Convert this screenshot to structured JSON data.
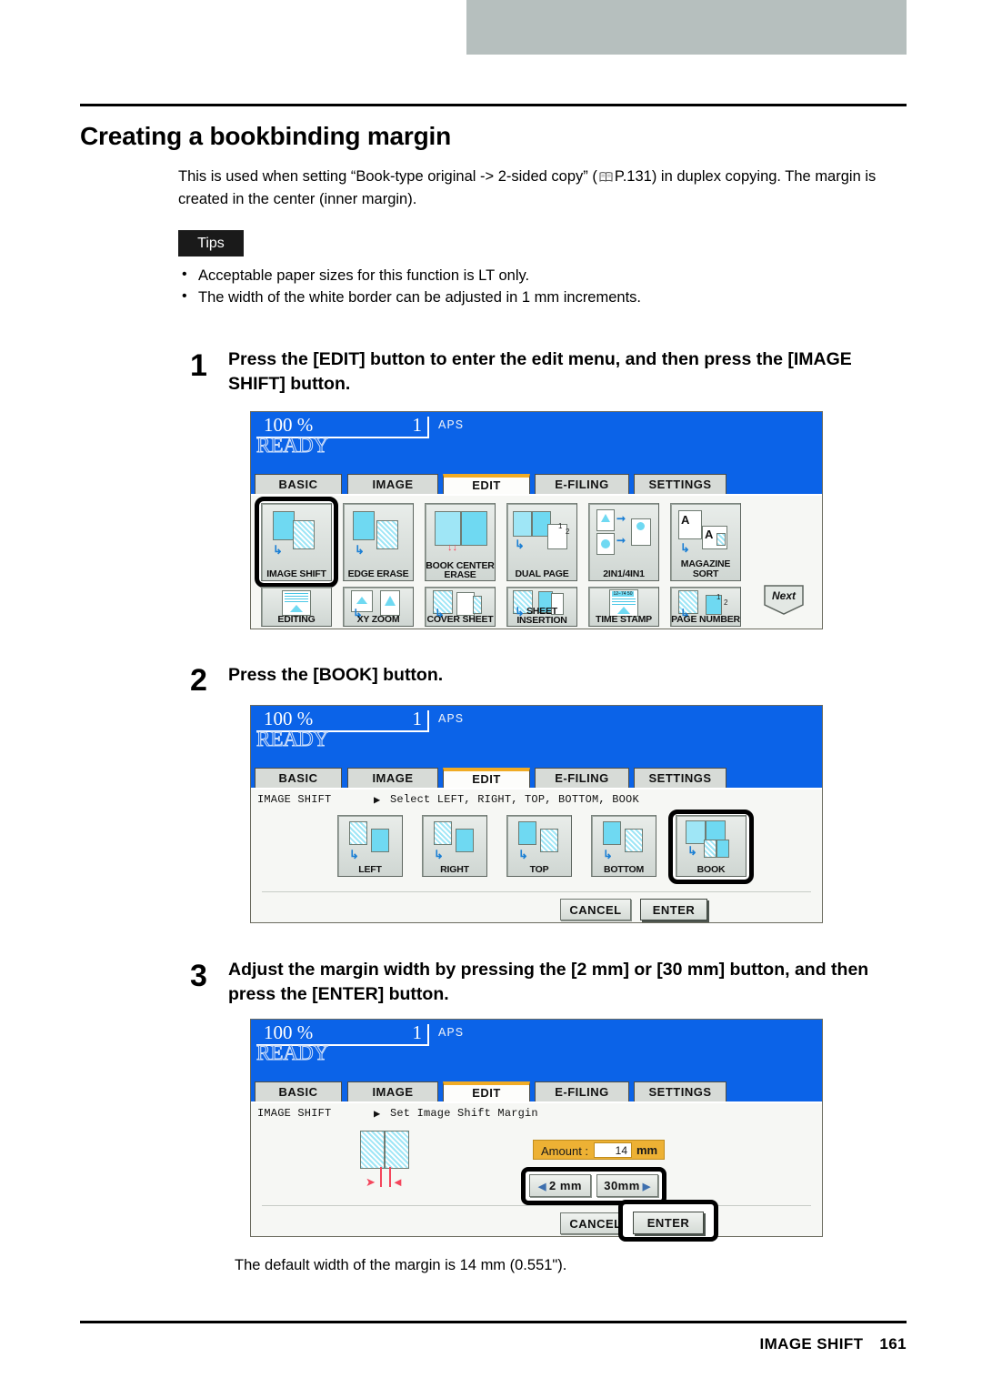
{
  "document": {
    "title": "Creating a bookbinding margin",
    "intro": "This is used when setting “Book-type original -> 2-sided copy” (  P.131) in duplex copying. The margin is created in the center (inner margin).",
    "intro_prefix": "This is used when setting “Book-type original -> 2-sided copy” (",
    "intro_ref": "P.131",
    "intro_suffix": ") in duplex copying. The margin is created in the center (inner margin).",
    "tips_label": "Tips",
    "tips": [
      "Acceptable paper sizes for this function is LT only.",
      "The width of the white border can be adjusted in 1 mm increments."
    ],
    "note": "The default width of the margin is 14 mm (0.551\").",
    "footer_title": "IMAGE SHIFT",
    "footer_page": "161"
  },
  "steps": [
    {
      "number": "1",
      "text": "Press the [EDIT] button to enter the edit menu, and then press the [IMAGE SHIFT] button."
    },
    {
      "number": "2",
      "text": "Press the [BOOK] button."
    },
    {
      "number": "3",
      "text": "Adjust the margin width by pressing the [2 mm] or [30 mm] button, and then press the [ENTER] button."
    }
  ],
  "lcd": {
    "ratio": "100  %",
    "copies": "1",
    "paper_mode": "APS",
    "status": "READY",
    "tabs": [
      {
        "label": "BASIC",
        "active": false
      },
      {
        "label": "IMAGE",
        "active": false
      },
      {
        "label": "EDIT",
        "active": true
      },
      {
        "label": "E-FILING",
        "active": false
      },
      {
        "label": "SETTINGS",
        "active": false
      }
    ]
  },
  "screen1": {
    "menu_row1": [
      {
        "label": "IMAGE SHIFT",
        "icon": "image-shift-icon",
        "selected": true
      },
      {
        "label": "EDGE ERASE",
        "icon": "edge-erase-icon",
        "selected": false
      },
      {
        "label_line1": "BOOK CENTER",
        "label_line2": "ERASE",
        "label": "BOOK CENTER ERASE",
        "icon": "book-center-erase-icon",
        "selected": false
      },
      {
        "label": "DUAL  PAGE",
        "icon": "dual-page-icon",
        "selected": false
      },
      {
        "label": "2IN1/4IN1",
        "icon": "2in1-4in1-icon",
        "selected": false
      },
      {
        "label": "MAGAZINE SORT",
        "icon": "magazine-sort-icon",
        "selected": false
      }
    ],
    "menu_row2": [
      {
        "label": "EDITING",
        "icon": "editing-icon",
        "selected": false
      },
      {
        "label": "XY ZOOM",
        "icon": "xy-zoom-icon",
        "selected": false
      },
      {
        "label": "COVER SHEET",
        "icon": "cover-sheet-icon",
        "selected": false
      },
      {
        "label_line1": "SHEET",
        "label_line2": "INSERTION",
        "label": "SHEET INSERTION",
        "icon": "sheet-insertion-icon",
        "selected": false
      },
      {
        "label": "TIME STAMP",
        "icon": "time-stamp-icon",
        "selected": false
      },
      {
        "label": "PAGE NUMBER",
        "icon": "page-number-icon",
        "selected": false
      }
    ],
    "next_label": "Next",
    "time_stamp_value": "12−74  50"
  },
  "screen2": {
    "status_title": "IMAGE SHIFT",
    "status_arrow": "▶",
    "status_message": "Select LEFT, RIGHT, TOP, BOTTOM, BOOK",
    "options": [
      {
        "label": "LEFT",
        "selected": false
      },
      {
        "label": "RIGHT",
        "selected": false
      },
      {
        "label": "TOP",
        "selected": false
      },
      {
        "label": "BOTTOM",
        "selected": false
      },
      {
        "label": "BOOK",
        "selected": true
      }
    ],
    "cancel_label": "CANCEL",
    "enter_label": "ENTER"
  },
  "screen3": {
    "status_title": "IMAGE SHIFT",
    "status_arrow": "▶",
    "status_message": "Set Image Shift Margin",
    "amount_caption": "Amount :",
    "amount_value": "14",
    "amount_unit": "mm",
    "dec_arrow": "◀",
    "dec_label": "2 mm",
    "inc_label": "30mm",
    "inc_arrow": "▶",
    "cancel_label": "CANCEL",
    "enter_label": "ENTER"
  },
  "colors": {
    "lcd_blue": "#0b63e8",
    "tab_active_accent": "#f0ab24",
    "amount_orange": "#edb134",
    "cyan": "#6fd9f2",
    "header_gray": "#b6bfbe",
    "arrow_red": "#f4465c"
  }
}
